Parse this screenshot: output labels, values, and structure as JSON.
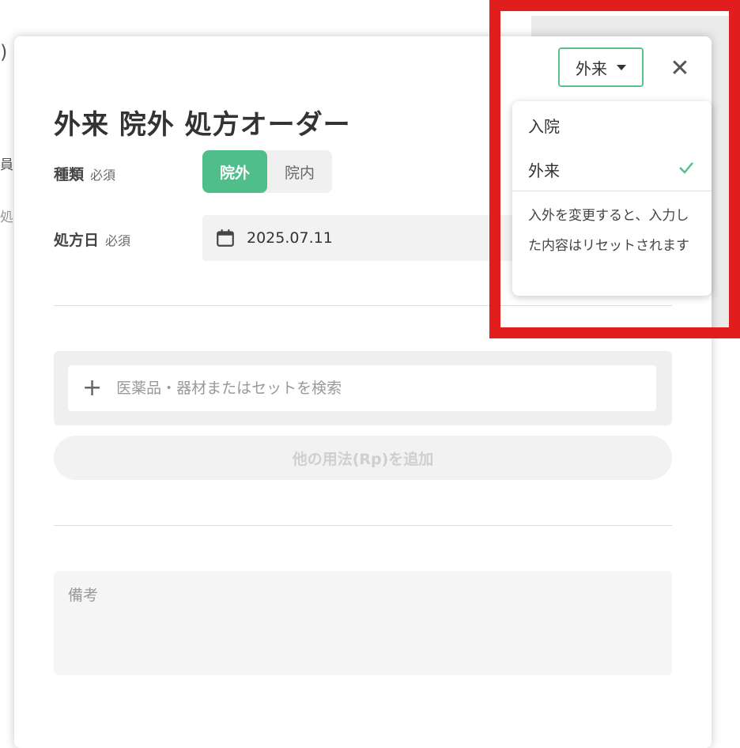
{
  "background": {
    "paren": ")",
    "frag_staff": "員",
    "frag_rx": "処"
  },
  "header": {
    "mode_select_value": "外来",
    "close_glyph": "✕"
  },
  "title": "外来 院外 処方オーダー",
  "type_field": {
    "label": "種類",
    "required": "必須",
    "options": [
      "院外",
      "院内"
    ],
    "selected": "院外"
  },
  "date_field": {
    "label": "処方日",
    "required": "必須",
    "value": "2025.07.11"
  },
  "search": {
    "placeholder": "医薬品・器材またはセットを検索"
  },
  "add_rp_label": "他の用法(Rp)を追加",
  "memo": {
    "placeholder": "備考"
  },
  "dropdown": {
    "items": [
      {
        "label": "入院",
        "checked": false
      },
      {
        "label": "外来",
        "checked": true
      }
    ],
    "note": "入外を変更すると、入力した内容はリセットされます"
  },
  "colors": {
    "accent_green": "#4fbe8a",
    "highlight_red": "#e21d1d"
  },
  "icons": [
    "caret-down-icon",
    "close-icon",
    "calendar-icon",
    "plus-icon",
    "check-icon"
  ]
}
